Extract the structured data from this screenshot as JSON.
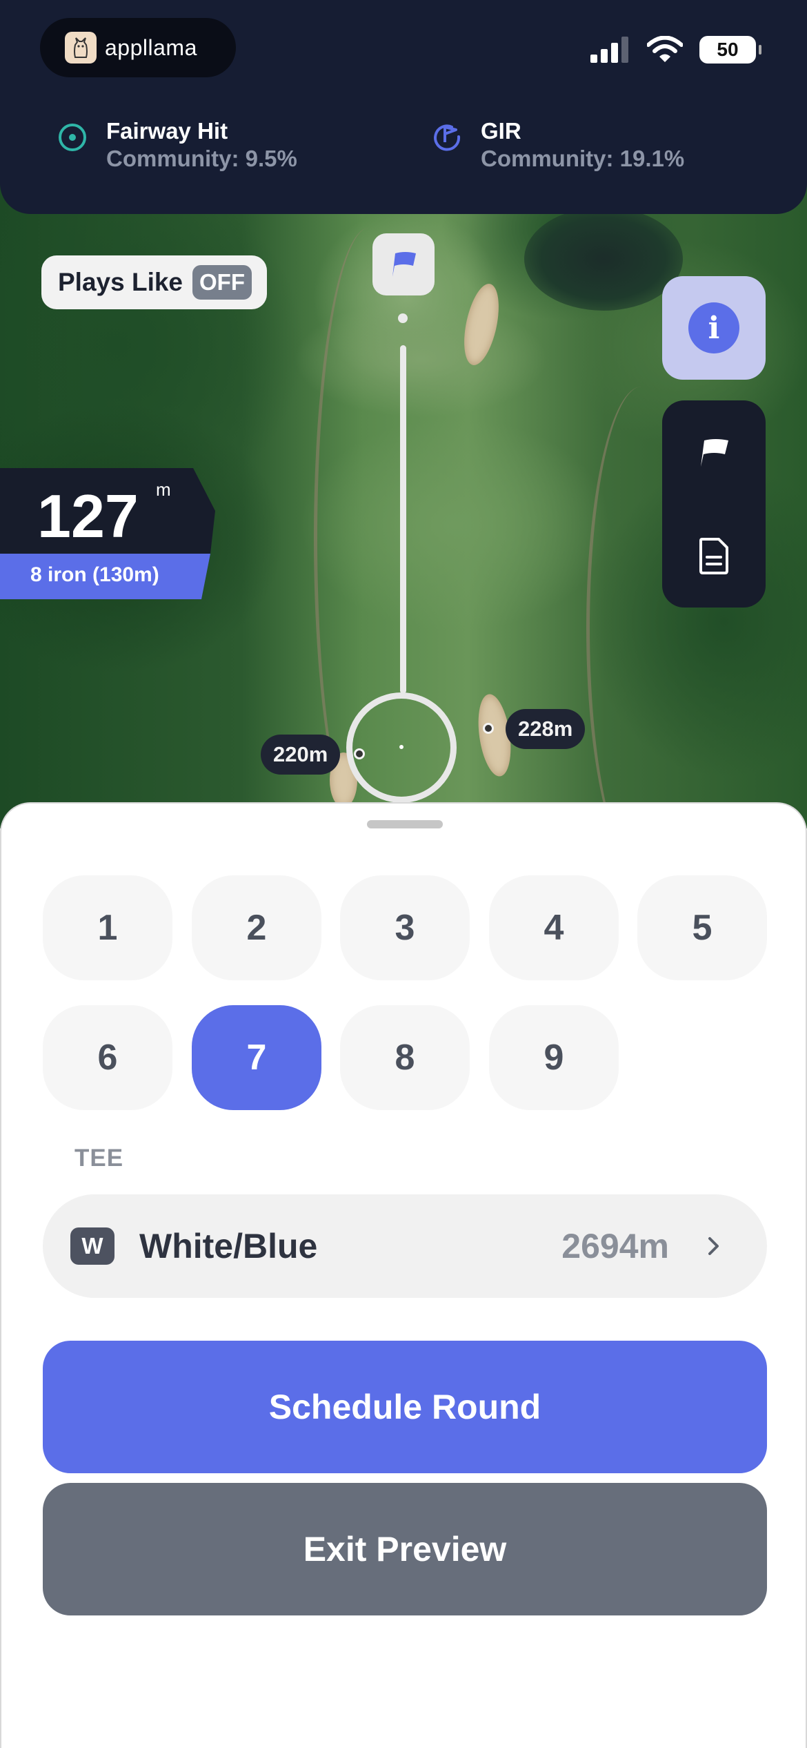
{
  "app": {
    "logo_text": "appllama"
  },
  "status_bar": {
    "battery": "50"
  },
  "header_stats": [
    {
      "title": "Fairway Hit",
      "subtitle": "Community: 9.5%"
    },
    {
      "title": "GIR",
      "subtitle": "Community: 19.1%"
    }
  ],
  "plays_like": {
    "label": "Plays Like",
    "state": "OFF"
  },
  "distance": {
    "value": "127",
    "unit": "m",
    "club": "8 iron (130m)"
  },
  "map_markers": {
    "left": "220m",
    "right": "228m"
  },
  "holes": {
    "items": [
      "1",
      "2",
      "3",
      "4",
      "5",
      "6",
      "7",
      "8",
      "9"
    ],
    "selected": "7"
  },
  "tee": {
    "section_label": "TEE",
    "badge": "W",
    "name": "White/Blue",
    "length": "2694m"
  },
  "actions": {
    "primary": "Schedule Round",
    "secondary": "Exit Preview"
  },
  "colors": {
    "accent": "#5b6ee8",
    "header_bg": "#161d33",
    "fairway_icon": "#2fb6a8",
    "gir_icon": "#5b6ee8"
  }
}
